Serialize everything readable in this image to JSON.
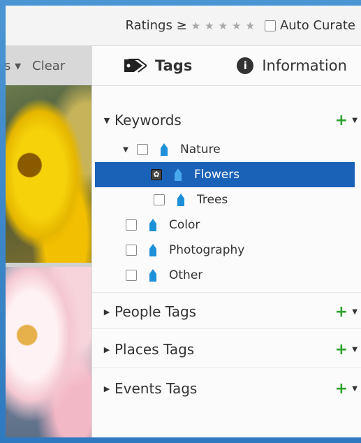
{
  "topbar": {
    "ratings_label": "Ratings ≥",
    "stars": [
      "★",
      "★",
      "★",
      "★",
      "★"
    ],
    "auto_curate_label": "Auto Curate"
  },
  "leftbar": {
    "sort_label": "s",
    "clear_label": "Clear"
  },
  "tabs": {
    "tags_label": "Tags",
    "info_label": "Information"
  },
  "sections": {
    "keywords": "Keywords",
    "people": "People Tags",
    "places": "Places Tags",
    "events": "Events Tags"
  },
  "keywords": [
    {
      "label": "Nature"
    },
    {
      "label": "Flowers"
    },
    {
      "label": "Trees"
    },
    {
      "label": "Color"
    },
    {
      "label": "Photography"
    },
    {
      "label": "Other"
    }
  ],
  "colors": {
    "accent": "#1a62b8",
    "add": "#2ea02e",
    "tag_icon": "#1e90d8"
  },
  "icons": [
    "tag-icon",
    "info-icon",
    "plus-icon",
    "star-icon",
    "checkbox-icon",
    "keyword-tag-icon"
  ]
}
